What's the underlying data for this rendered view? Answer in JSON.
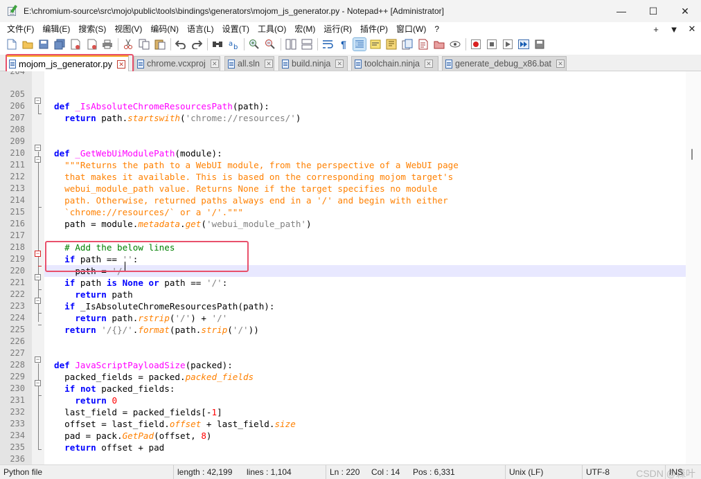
{
  "window": {
    "title": "E:\\chromium-source\\src\\mojo\\public\\tools\\bindings\\generators\\mojom_js_generator.py - Notepad++ [Administrator]",
    "minimize": "—",
    "maximize": "☐",
    "close": "✕"
  },
  "menu": {
    "items": [
      "文件(F)",
      "编辑(E)",
      "搜索(S)",
      "视图(V)",
      "编码(N)",
      "语言(L)",
      "设置(T)",
      "工具(O)",
      "宏(M)",
      "运行(R)",
      "插件(P)",
      "窗口(W)",
      "?"
    ],
    "right": [
      "+",
      "▼",
      "✕"
    ]
  },
  "tabs": [
    {
      "label": "mojom_js_generator.py",
      "active": true
    },
    {
      "label": "chrome.vcxproj",
      "active": false
    },
    {
      "label": "all.sln",
      "active": false
    },
    {
      "label": "build.ninja",
      "active": false
    },
    {
      "label": "toolchain.ninja",
      "active": false
    },
    {
      "label": "generate_debug_x86.bat",
      "active": false
    }
  ],
  "editor": {
    "first_line_partial": "204",
    "lines": [
      {
        "n": "205",
        "t": ""
      },
      {
        "n": "206",
        "t": "def _IsAbsoluteChromeResourcesPath(path):"
      },
      {
        "n": "207",
        "t": "  return path.startswith('chrome://resources/')"
      },
      {
        "n": "208",
        "t": ""
      },
      {
        "n": "209",
        "t": ""
      },
      {
        "n": "210",
        "t": "def _GetWebUiModulePath(module):"
      },
      {
        "n": "211",
        "t": "  \"\"\"Returns the path to a WebUI module, from the perspective of a WebUI page"
      },
      {
        "n": "212",
        "t": "  that makes it available. This is based on the corresponding mojom target's"
      },
      {
        "n": "213",
        "t": "  webui_module_path value. Returns None if the target specifies no module"
      },
      {
        "n": "214",
        "t": "  path. Otherwise, returned paths always end in a '/' and begin with either"
      },
      {
        "n": "215",
        "t": "  `chrome://resources/` or a '/'.\"\"\""
      },
      {
        "n": "216",
        "t": "  path = module.metadata.get('webui_module_path')"
      },
      {
        "n": "217",
        "t": ""
      },
      {
        "n": "218",
        "t": "  # Add the below lines"
      },
      {
        "n": "219",
        "t": "  if path == '':"
      },
      {
        "n": "220",
        "t": "    path = '/'"
      },
      {
        "n": "221",
        "t": "  if path is None or path == '/':"
      },
      {
        "n": "222",
        "t": "    return path"
      },
      {
        "n": "223",
        "t": "  if _IsAbsoluteChromeResourcesPath(path):"
      },
      {
        "n": "224",
        "t": "    return path.rstrip('/') + '/'"
      },
      {
        "n": "225",
        "t": "  return '/{}/'.format(path.strip('/'))"
      },
      {
        "n": "226",
        "t": ""
      },
      {
        "n": "227",
        "t": ""
      },
      {
        "n": "228",
        "t": "def JavaScriptPayloadSize(packed):"
      },
      {
        "n": "229",
        "t": "  packed_fields = packed.packed_fields"
      },
      {
        "n": "230",
        "t": "  if not packed_fields:"
      },
      {
        "n": "231",
        "t": "    return 0"
      },
      {
        "n": "232",
        "t": "  last_field = packed_fields[-1]"
      },
      {
        "n": "233",
        "t": "  offset = last_field.offset + last_field.size"
      },
      {
        "n": "234",
        "t": "  pad = pack.GetPad(offset, 8)"
      },
      {
        "n": "235",
        "t": "  return offset + pad"
      },
      {
        "n": "236",
        "t": ""
      }
    ]
  },
  "status": {
    "language": "Python file",
    "length": "length : 42,199",
    "lines": "lines : 1,104",
    "ln": "Ln : 220",
    "col": "Col : 14",
    "pos": "Pos : 6,331",
    "eol": "Unix (LF)",
    "encoding": "UTF-8",
    "mode": "INS"
  },
  "watermark": "CSDN @森叶",
  "colors": {
    "keyword": "#0000ff",
    "function_name": "#ff00ff",
    "method": "#ff8000",
    "docstring": "#ff8000",
    "string": "#808080",
    "number": "#ff0000",
    "comment": "#008000",
    "highlight_box": "#e8506b",
    "active_tab_accent": "#f5a623"
  }
}
